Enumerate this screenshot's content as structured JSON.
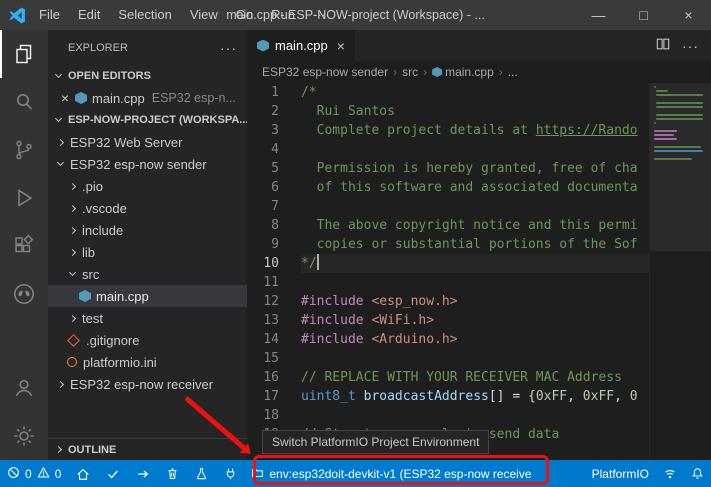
{
  "colors": {
    "statusbar_blue": "#007acc",
    "annotation_red": "#ee1111",
    "tok_comment": "#6a9955",
    "tok_macro": "#c586c0",
    "tok_string": "#ce9178",
    "tok_keyword": "#569cd6",
    "tok_variable": "#9cdcfe",
    "tok_number": "#b5cea8",
    "tok_punct": "#d4d4d4",
    "cpp_icon": "#519aba",
    "git_icon": "#e8654a",
    "pio_file_icon": "#f58220"
  },
  "title_bar": {
    "menus": [
      "File",
      "Edit",
      "Selection",
      "View",
      "Go",
      "Run",
      "···"
    ],
    "title": "main.cpp - ESP-NOW-project (Workspace) - ...",
    "controls": {
      "minimize": "—",
      "maximize": "□",
      "close": "×"
    }
  },
  "activity_bar": {
    "items": [
      {
        "name": "explorer",
        "active": true
      },
      {
        "name": "search"
      },
      {
        "name": "source-control"
      },
      {
        "name": "run-debug"
      },
      {
        "name": "extensions"
      },
      {
        "name": "platformio"
      }
    ],
    "bottom_items": [
      {
        "name": "account"
      },
      {
        "name": "settings"
      }
    ]
  },
  "sidebar": {
    "title": "EXPLORER",
    "actions": "···",
    "open_editors": {
      "header": "OPEN EDITORS",
      "items": [
        {
          "close": "×",
          "name": "main.cpp",
          "description": "ESP32 esp-n...",
          "icon": "cpp"
        }
      ]
    },
    "workspace": {
      "header": "ESP-NOW-PROJECT (WORKSPA..."
    },
    "tree": [
      {
        "label": "ESP32 Web Server",
        "indent": 0,
        "chevron": "collapsed"
      },
      {
        "label": "ESP32 esp-now sender",
        "indent": 0,
        "chevron": "expanded"
      },
      {
        "label": ".pio",
        "indent": 1,
        "chevron": "collapsed"
      },
      {
        "label": ".vscode",
        "indent": 1,
        "chevron": "collapsed"
      },
      {
        "label": "include",
        "indent": 1,
        "chevron": "collapsed"
      },
      {
        "label": "lib",
        "indent": 1,
        "chevron": "collapsed"
      },
      {
        "label": "src",
        "indent": 1,
        "chevron": "expanded"
      },
      {
        "label": "main.cpp",
        "indent": 2,
        "icon": "cpp",
        "selected": true
      },
      {
        "label": "test",
        "indent": 1,
        "chevron": "collapsed"
      },
      {
        "label": ".gitignore",
        "indent": 1,
        "icon": "git"
      },
      {
        "label": "platformio.ini",
        "indent": 1,
        "icon": "pio"
      },
      {
        "label": "ESP32 esp-now receiver",
        "indent": 0,
        "chevron": "collapsed"
      }
    ],
    "outline": {
      "header": "OUTLINE"
    }
  },
  "editor": {
    "tabs": [
      {
        "label": "main.cpp",
        "icon": "cpp",
        "close": "×",
        "active": true
      }
    ],
    "more_actions": "···",
    "breadcrumbs": [
      {
        "label": "ESP32 esp-now sender"
      },
      {
        "label": "src"
      },
      {
        "label": "main.cpp",
        "icon": "cpp"
      },
      {
        "label": "..."
      }
    ],
    "tooltip": "Switch PlatformIO Project Environment",
    "code": {
      "lines": [
        {
          "n": 1,
          "tokens": [
            [
              "/*",
              "comment"
            ]
          ]
        },
        {
          "n": 2,
          "tokens": [
            [
              "  Rui Santos",
              "comment"
            ]
          ]
        },
        {
          "n": 3,
          "tokens": [
            [
              "  Complete project details at ",
              "comment"
            ],
            [
              "https://Rando",
              "comment-link"
            ]
          ]
        },
        {
          "n": 4,
          "tokens": []
        },
        {
          "n": 5,
          "tokens": [
            [
              "  Permission is hereby granted, free of cha",
              "comment"
            ]
          ]
        },
        {
          "n": 6,
          "tokens": [
            [
              "  of this software and associated documenta",
              "comment"
            ]
          ]
        },
        {
          "n": 7,
          "tokens": []
        },
        {
          "n": 8,
          "tokens": [
            [
              "  The above copyright notice and this permi",
              "comment"
            ]
          ]
        },
        {
          "n": 9,
          "tokens": [
            [
              "  copies or substantial portions of the Sof",
              "comment"
            ]
          ]
        },
        {
          "n": 10,
          "tokens": [
            [
              "*/",
              "comment"
            ]
          ],
          "cursor": true,
          "active": true
        },
        {
          "n": 11,
          "tokens": []
        },
        {
          "n": 12,
          "tokens": [
            [
              "#include",
              "macro"
            ],
            [
              " ",
              "plain"
            ],
            [
              "<esp_now.h>",
              "string"
            ]
          ]
        },
        {
          "n": 13,
          "tokens": [
            [
              "#include",
              "macro"
            ],
            [
              " ",
              "plain"
            ],
            [
              "<WiFi.h>",
              "string"
            ]
          ]
        },
        {
          "n": 14,
          "tokens": [
            [
              "#include",
              "macro"
            ],
            [
              " ",
              "plain"
            ],
            [
              "<Arduino.h>",
              "string"
            ]
          ]
        },
        {
          "n": 15,
          "tokens": []
        },
        {
          "n": 16,
          "tokens": [
            [
              "// REPLACE WITH YOUR RECEIVER MAC Address",
              "comment"
            ]
          ]
        },
        {
          "n": 17,
          "tokens": [
            [
              "uint8_t",
              "keyword"
            ],
            [
              " ",
              "plain"
            ],
            [
              "broadcastAddress",
              "variable"
            ],
            [
              "[] = {",
              "punct"
            ],
            [
              "0xFF",
              "number"
            ],
            [
              ", ",
              "punct"
            ],
            [
              "0xFF",
              "number"
            ],
            [
              ", ",
              "punct"
            ],
            [
              "0",
              "number"
            ]
          ]
        },
        {
          "n": 18,
          "tokens": []
        },
        {
          "n": 19,
          "tokens": [
            [
              "// Structure example to send data",
              "comment"
            ]
          ]
        }
      ]
    }
  },
  "status_bar": {
    "problems": {
      "errors": "0",
      "warnings": "0"
    },
    "pio_buttons": [
      "home",
      "build",
      "upload",
      "clean",
      "test",
      "serial-monitor"
    ],
    "env": {
      "label": "env:esp32doit-devkit-v1 (ESP32 esp-now receive"
    },
    "platformio": "PlatformIO"
  }
}
